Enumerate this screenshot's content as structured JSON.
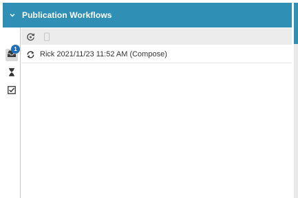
{
  "panel": {
    "title": "Publication Workflows",
    "collapse_icon": "chevron-down-icon"
  },
  "side_tabs": [
    {
      "icon": "inbox-icon",
      "badge": "1",
      "active": true
    },
    {
      "icon": "hourglass-icon",
      "active": false
    },
    {
      "icon": "checkbox-icon",
      "active": false
    }
  ],
  "toolbar": {
    "icons": [
      "refresh-icon",
      "delete-icon"
    ]
  },
  "workflows": [
    {
      "icon": "workflow-cycle-icon",
      "label": "Rick 2021/11/23 11:52 AM (Compose)"
    }
  ],
  "colors": {
    "header": "#2f8fb5",
    "badge": "#1e6fb8",
    "toolbar": "#ececec"
  }
}
